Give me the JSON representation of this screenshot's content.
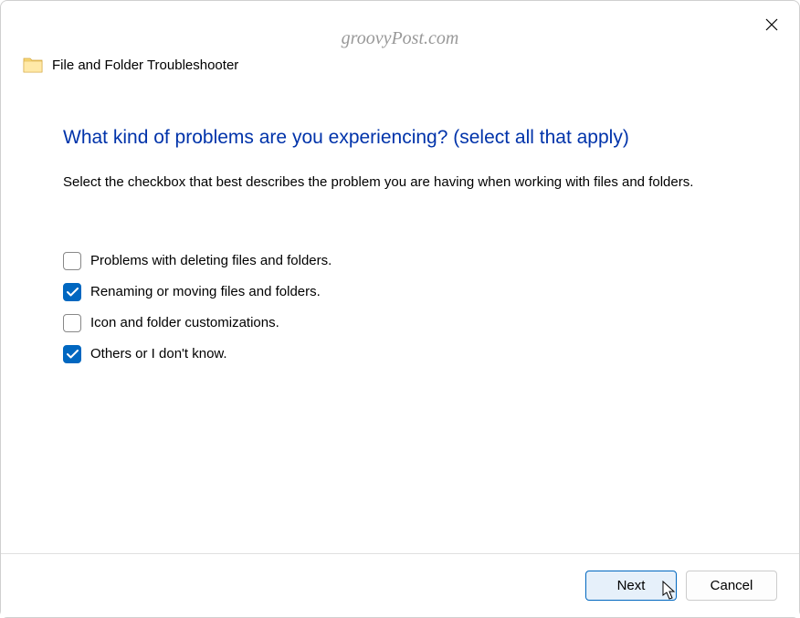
{
  "watermark": "groovyPost.com",
  "header": {
    "title": "File and Folder Troubleshooter"
  },
  "main": {
    "heading": "What kind of problems are you experiencing? (select all that apply)",
    "description": "Select the checkbox that best describes the problem you are having when working with files and folders."
  },
  "options": [
    {
      "label": "Problems with deleting files and folders.",
      "checked": false
    },
    {
      "label": "Renaming or moving files and folders.",
      "checked": true
    },
    {
      "label": "Icon and folder customizations.",
      "checked": false
    },
    {
      "label": "Others or I don't know.",
      "checked": true
    }
  ],
  "footer": {
    "next": "Next",
    "cancel": "Cancel"
  }
}
